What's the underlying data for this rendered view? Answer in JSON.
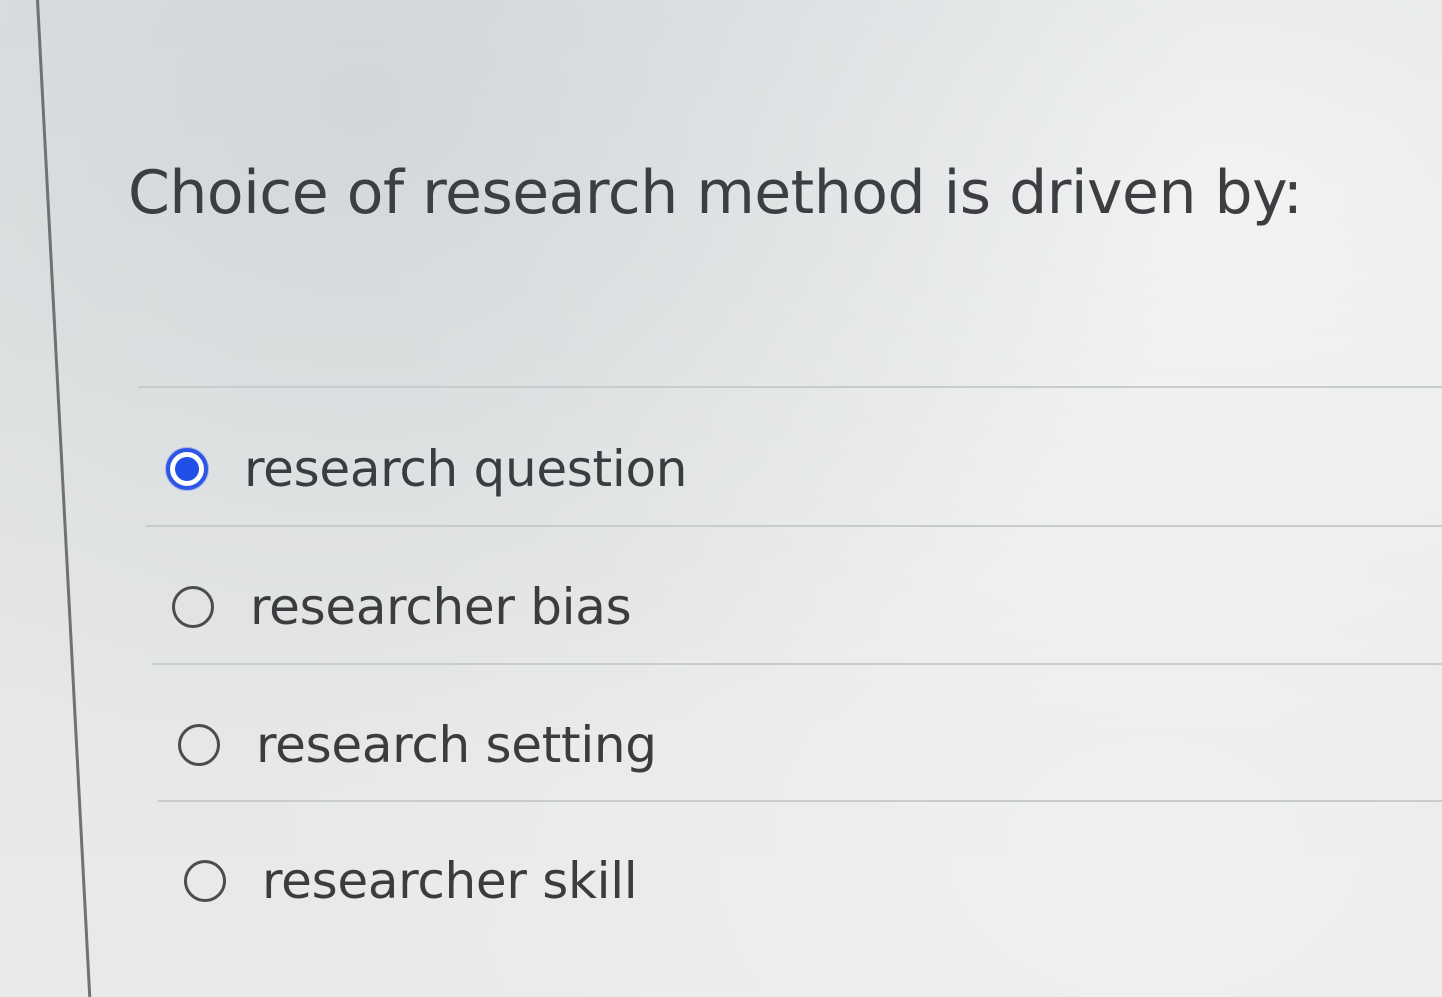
{
  "question": {
    "text": "Choice of research method is driven by:"
  },
  "options": [
    {
      "label": "research question",
      "selected": true
    },
    {
      "label": "researcher bias",
      "selected": false
    },
    {
      "label": "research setting",
      "selected": false
    },
    {
      "label": "researcher skill",
      "selected": false
    }
  ],
  "colors": {
    "accent": "#2d55e6",
    "text": "#3a3c3f",
    "divider": "#c9cccd"
  }
}
